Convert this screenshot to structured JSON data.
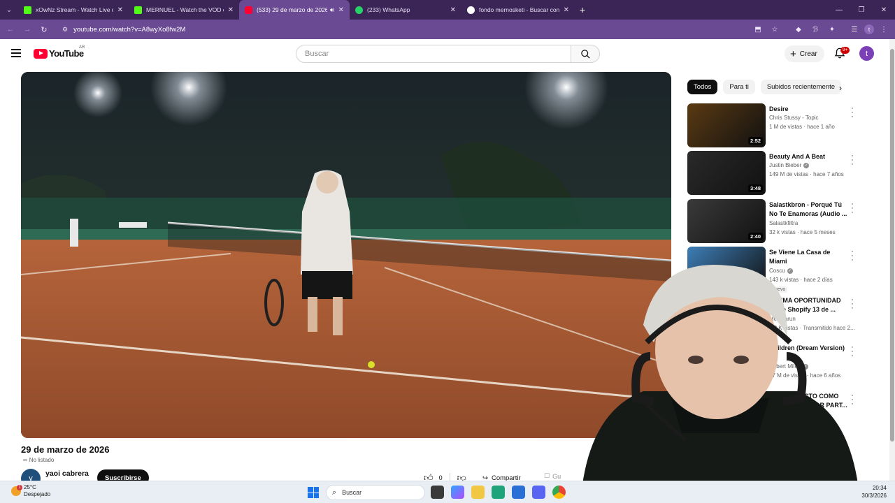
{
  "browser": {
    "tabs": [
      {
        "title": "xOwNz Stream - Watch Live on",
        "favicon": "kick-icon",
        "active": false
      },
      {
        "title": "MERNUEL - Watch the VOD on",
        "favicon": "kick-icon",
        "active": false
      },
      {
        "title": "(533) 29 de marzo de 2026",
        "favicon": "youtube-icon",
        "active": true
      },
      {
        "title": "(233) WhatsApp",
        "favicon": "whatsapp-icon",
        "active": false
      },
      {
        "title": "fondo mernosketi - Buscar con",
        "favicon": "google-icon",
        "active": false
      }
    ],
    "url": "youtube.com/watch?v=A8wyXo8fw2M"
  },
  "youtube": {
    "logo_text": "YouTube",
    "region": "AR",
    "search_placeholder": "Buscar",
    "create_label": "Crear",
    "notifications_badge": "9+",
    "avatar_letter": "t"
  },
  "video": {
    "title": "29 de marzo de 2026",
    "visibility": "No listado",
    "channel": "yaoi cabrera",
    "channel_initial": "y",
    "subscribe_label": "Suscribirse",
    "likes": "0",
    "share_label": "Compartir",
    "save_label": "Gu"
  },
  "chips": [
    "Todos",
    "Para ti",
    "Subidos recientemente"
  ],
  "recommendations": [
    {
      "title": "Desire",
      "channel": "Chris Stussy - Topic",
      "verified": false,
      "meta": "1 M de vistas · hace 1 año",
      "duration": "2:52",
      "badge": "",
      "thumb_color": "#5a3a12"
    },
    {
      "title": "Beauty And A Beat",
      "channel": "Justin Bieber",
      "verified": true,
      "meta": "149 M de vistas · hace 7 años",
      "duration": "3:48",
      "badge": "",
      "thumb_color": "#2a2a2a"
    },
    {
      "title": "Salastkbron - Porqué Tú No Te Enamoras (Audio ...",
      "channel": "Salastkfiltra",
      "verified": false,
      "meta": "32 k vistas · hace 5 meses",
      "duration": "2:40",
      "badge": "",
      "thumb_color": "#3a3a3a"
    },
    {
      "title": "Se Viene La Casa de Miami",
      "channel": "Coscu",
      "verified": true,
      "meta": "143 k vistas · hace 2 días",
      "duration": "23:45",
      "badge": "Nuevo",
      "thumb_color": "#3d7fb8"
    },
    {
      "title": "ÚLTIMA OPORTUNIDAD Clase Shopify 13 de ...",
      "channel": "Mel Marun",
      "verified": false,
      "meta": "2.2 K vistas · Transmitido hace 2...",
      "duration": "28",
      "badge": "",
      "thumb_color": "#c0307a"
    },
    {
      "title": "Children (Dream Version)",
      "channel": "Robert Miles",
      "verified": true,
      "meta": "27 M de vistas · hace 6 años",
      "duration": "07",
      "badge": "",
      "thumb_color": "#2b4ec2"
    },
    {
      "title": "¿CUENTA ESTO COMO INFIDELIDAD POR PART...",
      "channel": "",
      "verified": false,
      "meta": "día",
      "duration": "",
      "badge": "",
      "thumb_color": "#202020"
    }
  ],
  "taskbar": {
    "temperature": "25°C",
    "weather": "Despejado",
    "search_label": "Buscar",
    "time": "20:34",
    "date": "30/3/2026"
  }
}
